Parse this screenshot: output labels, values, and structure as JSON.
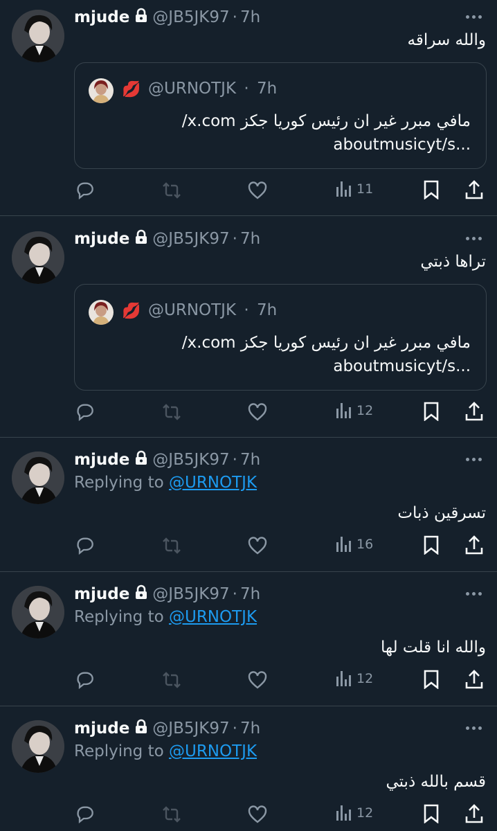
{
  "colors": {
    "background": "#15202b",
    "text": "#f7f9f9",
    "muted": "#8b98a5",
    "link": "#1d9bf0",
    "border": "#38444d"
  },
  "icons": [
    "lock-icon",
    "more-icon",
    "reply-icon",
    "retweet-icon",
    "like-icon",
    "views-icon",
    "bookmark-icon",
    "share-icon"
  ],
  "tweets": [
    {
      "name": "mjude",
      "handle": "@JB5JK97",
      "sep": "·",
      "time": "7h",
      "text": "والله سراقه",
      "quote": {
        "emoji": "💋",
        "handle": "@URNOTJK",
        "sep": "·",
        "time": "7h",
        "line1": "مافي مبرر غير ان رئيس كوريا جكز x.com/",
        "line2": "aboutmusicyt/s..."
      },
      "views": "11"
    },
    {
      "name": "mjude",
      "handle": "@JB5JK97",
      "sep": "·",
      "time": "7h",
      "text": "تراها ذبتي",
      "quote": {
        "emoji": "💋",
        "handle": "@URNOTJK",
        "sep": "·",
        "time": "7h",
        "line1": "مافي مبرر غير ان رئيس كوريا جكز x.com/",
        "line2": "aboutmusicyt/s..."
      },
      "views": "12"
    },
    {
      "name": "mjude",
      "handle": "@JB5JK97",
      "sep": "·",
      "time": "7h",
      "replying_prefix": "Replying to ",
      "replying_to": "@URNOTJK",
      "text": "تسرقين ذبات",
      "views": "16"
    },
    {
      "name": "mjude",
      "handle": "@JB5JK97",
      "sep": "·",
      "time": "7h",
      "replying_prefix": "Replying to ",
      "replying_to": "@URNOTJK",
      "text": "والله انا قلت لها",
      "views": "12"
    },
    {
      "name": "mjude",
      "handle": "@JB5JK97",
      "sep": "·",
      "time": "7h",
      "replying_prefix": "Replying to ",
      "replying_to": "@URNOTJK",
      "text": "قسم بالله ذبتي",
      "views": "12"
    }
  ]
}
